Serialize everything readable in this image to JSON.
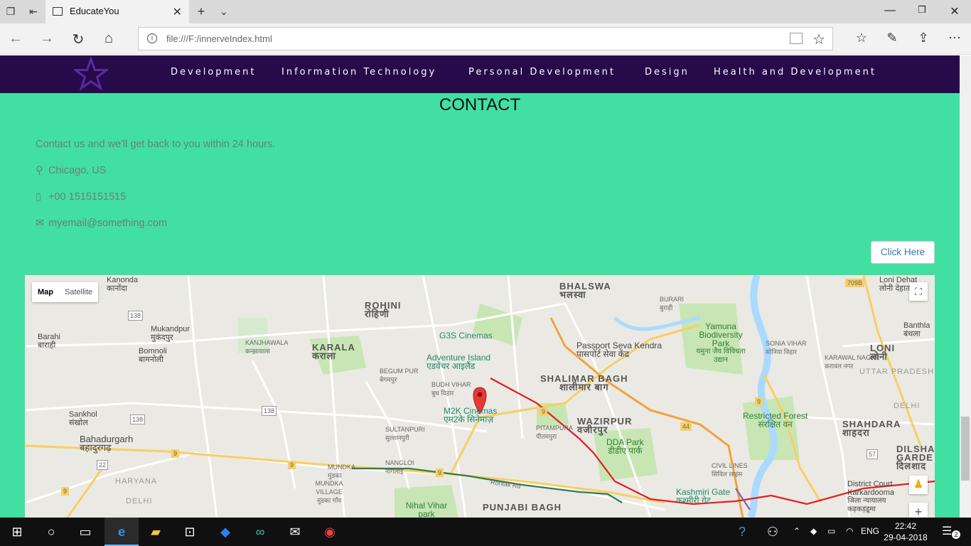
{
  "browser": {
    "tab_title": "EducateYou",
    "url": "file:///F:/innerveIndex.html"
  },
  "site": {
    "nav": [
      "Development",
      "Information Technology",
      "Personal Development",
      "Design",
      "Health and Development"
    ],
    "logo": "star-logo"
  },
  "contact": {
    "title": "CONTACT",
    "intro": "Contact us and we'll get back to you within 24 hours.",
    "location": "Chicago, US",
    "phone": "+00 1515151515",
    "email": "myemail@something.com",
    "button": "Click Here"
  },
  "map": {
    "type_map": "Map",
    "type_satellite": "Satellite",
    "labels": {
      "kanonda": "Kanonda",
      "kanonda_hi": "कानोंदा",
      "rohini": "ROHINI",
      "rohini_hi": "रोहिणी",
      "bhalswa": "BHALSWA",
      "bhalswa_hi": "भलस्वा",
      "burari": "BURARI",
      "burari_hi": "बुराड़ी",
      "loni_dehat": "Loni Dehat",
      "loni_dehat_hi": "लोनी देहात",
      "barahi": "Barahi",
      "barahi_hi": "बाराही",
      "mukandpur": "Mukandpur",
      "mukandpur_hi": "मुकंदपुर",
      "bomnoli": "Bomnoli",
      "bomnoli_hi": "बामनोली",
      "kanjhawala": "KANJHAWALA",
      "kanjhawala_hi": "कन्झावाला",
      "karala": "KARALA",
      "karala_hi": "कराला",
      "g3s": "G3S Cinemas",
      "adventure": "Adventure Island",
      "adventure_hi": "एडवेंचर आइलैंड",
      "passport": "Passport Seva Kendra",
      "passport_hi": "पासपोर्ट सेवा केंद्र",
      "yamuna": "Yamuna Biodiversity Park",
      "yamuna_hi": "यमुना जैव विविधता उद्यान",
      "sonia_vihar": "SONIA VIHAR",
      "sonia_vihar_hi": "सोनिया विहार",
      "karawal": "KARAWAL NAGAR",
      "karawal_hi": "करावल नगर",
      "loni": "LONI",
      "loni_hi": "लोनी",
      "banthla": "Banthla",
      "banthla_hi": "बंथला",
      "uttar_pradesh": "UTTAR PRADESH",
      "delhi_state": "DELHI",
      "begum_pur": "BEGUM PUR",
      "begum_pur_hi": "बेगमपुर",
      "budh_vihar": "BUDH VIHAR",
      "budh_vihar_hi": "बुध विहार",
      "shalimar": "SHALIMAR BAGH",
      "shalimar_hi": "शालीमार बाग",
      "m2k": "M2K Cinemas",
      "m2k_hi": "एम2के सिनेमाज़",
      "sankhol": "Sankhol",
      "sankhol_hi": "संखोल",
      "bahadurgarh": "Bahadurgarh",
      "bahadurgarh_hi": "बहादुरगढ़",
      "sultanpuri": "SULTANPURI",
      "sultanpuri_hi": "सुल्तानपुरी",
      "pitampura": "PITAMPURA",
      "pitampura_hi": "पीतमपुरा",
      "wazirpur": "WAZIRPUR",
      "wazirpur_hi": "वजीरपुर",
      "dda_park": "DDA Park",
      "dda_park_hi": "डीडीए पार्क",
      "restricted": "Restricted Forest",
      "restricted_hi": "संरक्षित वन",
      "shahdara": "SHAHDARA",
      "shahdara_hi": "शाहदरा",
      "dilsha": "DILSHA GARDE",
      "dilsha_hi": "दिलशाद",
      "mundka": "MUNDKA",
      "mundka_hi": "मुंडका",
      "nangloi": "NANGLOI",
      "nangloi_hi": "नांगलोई",
      "haryana": "HARYANA",
      "delhi_left": "DELHI",
      "mundka_village": "MUNDKA VILLAGE",
      "mundka_village_hi": "मुंडका गाँव",
      "rohtak_rd": "Rohtak Rd",
      "nihal_vihar": "Nihal Vihar park",
      "punjabi_bagh": "PUNJABI BAGH",
      "civil_lines": "CIVIL LINES",
      "civil_lines_hi": "सिविल लाइंस",
      "kashmiri_gate": "Kashmiri Gate",
      "kashmiri_gate_hi": "कश्मीरी गेट",
      "district_court": "District Court Karkardooma",
      "district_court_hi": "जिला न्यायालय कड़कड़डूमा",
      "shield_138a": "138",
      "shield_138b": "138",
      "shield_138c": "138",
      "shield_9a": "9",
      "shield_9b": "9",
      "shield_9c": "9",
      "shield_9d": "9",
      "shield_9e": "9",
      "shield_9f": "9",
      "shield_44": "44",
      "shield_22": "22",
      "shield_709b": "709B",
      "shield_57": "57"
    }
  },
  "taskbar": {
    "time": "22:42",
    "date": "29-04-2018",
    "lang": "ENG",
    "notifications": "2"
  }
}
